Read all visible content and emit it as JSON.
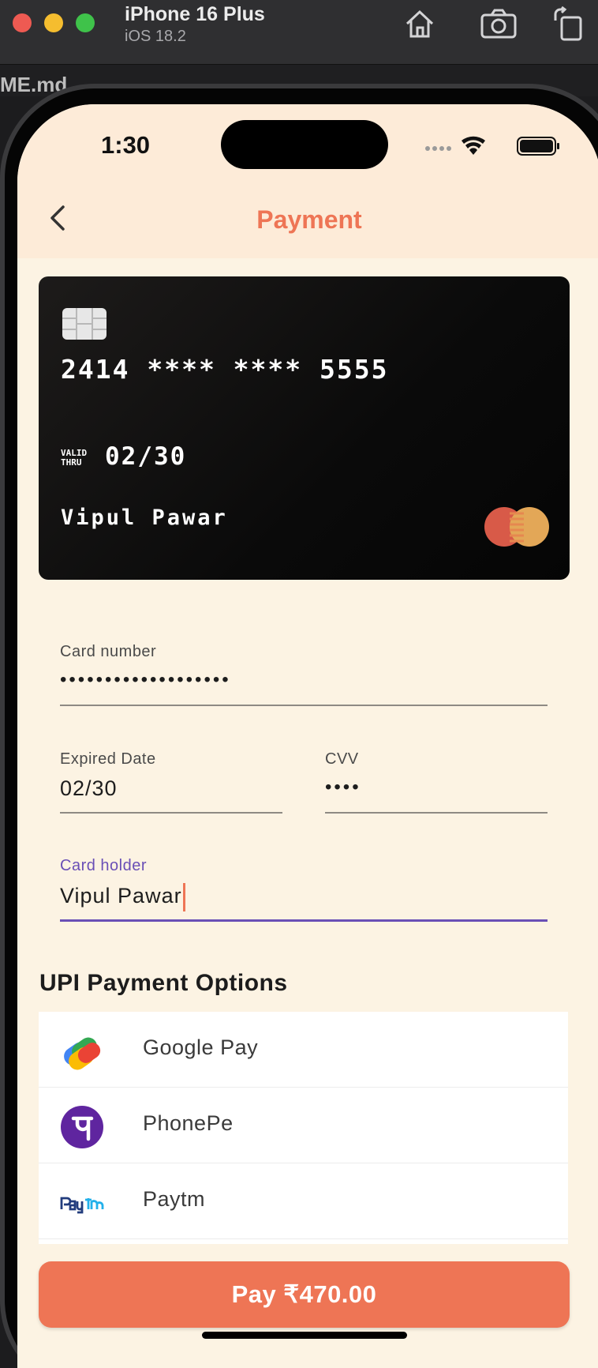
{
  "simulator": {
    "device_name": "iPhone 16 Plus",
    "os_version": "iOS 18.2",
    "behind_text": "ME.md"
  },
  "status_bar": {
    "time": "1:30"
  },
  "nav": {
    "title": "Payment"
  },
  "card": {
    "number": "2414 **** **** 5555",
    "valid_line1": "VALID",
    "valid_line2": "THRU",
    "expiry": "02/30",
    "holder": "Vipul Pawar"
  },
  "form": {
    "card_number": {
      "label": "Card number",
      "value": "•••••••••••••••••••"
    },
    "expired_date": {
      "label": "Expired Date",
      "value": "02/30"
    },
    "cvv": {
      "label": "CVV",
      "value": "••••"
    },
    "card_holder": {
      "label": "Card holder",
      "value": "Vipul Pawar"
    }
  },
  "upi": {
    "title": "UPI Payment Options",
    "options": [
      {
        "label": "Google Pay",
        "icon": "google-pay-icon"
      },
      {
        "label": "PhonePe",
        "icon": "phonepe-icon"
      },
      {
        "label": "Paytm",
        "icon": "paytm-icon"
      }
    ]
  },
  "pay_button": {
    "label": "Pay ₹470.00"
  },
  "colors": {
    "accent": "#ee7555",
    "focus": "#6a4fb6",
    "background": "#fcf3e3",
    "header": "#fdebd8"
  }
}
